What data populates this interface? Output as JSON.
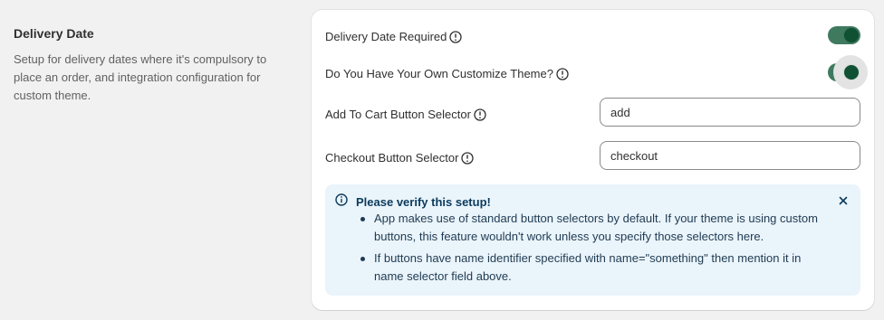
{
  "section": {
    "title": "Delivery Date",
    "description": "Setup for delivery dates where it's compulsory to place an order, and integration configuration for custom theme."
  },
  "settings": {
    "delivery_required": {
      "label": "Delivery Date Required",
      "enabled": true
    },
    "custom_theme": {
      "label": "Do You Have Your Own Customize Theme?",
      "enabled": true
    },
    "add_to_cart": {
      "label": "Add To Cart Button Selector",
      "value": "add"
    },
    "checkout": {
      "label": "Checkout Button Selector",
      "value": "checkout"
    }
  },
  "banner": {
    "title": "Please verify this setup!",
    "items": [
      "App makes use of standard button selectors by default. If your theme is using custom buttons, this feature wouldn't work unless you specify those selectors here.",
      "If buttons have name identifier specified with name=\"something\" then mention it in name selector field above."
    ]
  },
  "icons": {
    "info": "info-circle-icon",
    "close": "close-icon"
  },
  "colors": {
    "toggle_on": "#0f5132",
    "banner_bg": "#eaf4fb",
    "card_bg": "#ffffff",
    "page_bg": "#f1f1f1"
  }
}
